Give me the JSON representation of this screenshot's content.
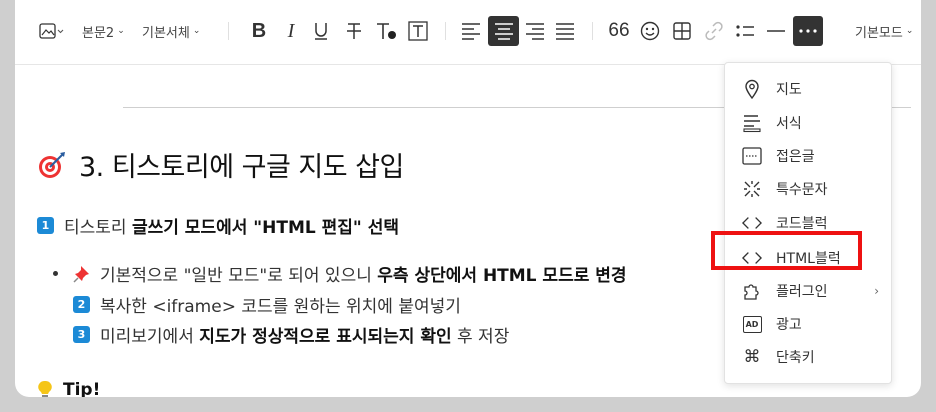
{
  "toolbar": {
    "paragraph_style": "본문2",
    "font_family": "기본서체",
    "mode": "기본모드",
    "quote_glyph": "66",
    "icons": [
      "image-icon",
      "bold-icon",
      "italic-icon",
      "underline-icon",
      "strikethrough-icon",
      "text-color-icon",
      "text-background-icon",
      "align-left-icon",
      "align-center-icon",
      "align-right-icon",
      "align-justify-icon",
      "quote-icon",
      "emoji-icon",
      "table-icon",
      "link-icon",
      "list-icon",
      "divider-icon",
      "more-icon"
    ]
  },
  "content": {
    "heading": "3. 티스토리에 구글 지도 삽입",
    "step1": {
      "num": "1",
      "pre": "티스토리 ",
      "bold": "글쓰기 모드에서 \"HTML 편집\" 선택"
    },
    "bullet": {
      "pre": "기본적으로 \"일반 모드\"로 되어 있으니 ",
      "bold": "우측 상단에서 HTML 모드로 변경"
    },
    "step2": {
      "num": "2",
      "text": "복사한 <iframe> 코드를 원하는 위치에 붙여넣기"
    },
    "step3": {
      "num": "3",
      "pre": "미리보기에서 ",
      "bold": "지도가 정상적으로 표시되는지 확인",
      "post": " 후 저장"
    },
    "tip": "Tip!"
  },
  "menu": {
    "items": [
      {
        "label": "지도",
        "icon": "map-pin-icon"
      },
      {
        "label": "서식",
        "icon": "format-icon"
      },
      {
        "label": "접은글",
        "icon": "fold-icon"
      },
      {
        "label": "특수문자",
        "icon": "special-char-icon"
      },
      {
        "label": "코드블럭",
        "icon": "code-icon"
      },
      {
        "label": "HTML블럭",
        "icon": "html-code-icon"
      },
      {
        "label": "플러그인",
        "icon": "plugin-icon",
        "arrow": "›"
      },
      {
        "label": "광고",
        "icon": "ad-icon",
        "badge": "AD"
      },
      {
        "label": "단축키",
        "icon": "shortcut-icon",
        "glyph": "⌘"
      }
    ]
  },
  "colors": {
    "active_button": "#333333",
    "step_badge": "#1c8ad6",
    "highlight": "#ee1111"
  }
}
